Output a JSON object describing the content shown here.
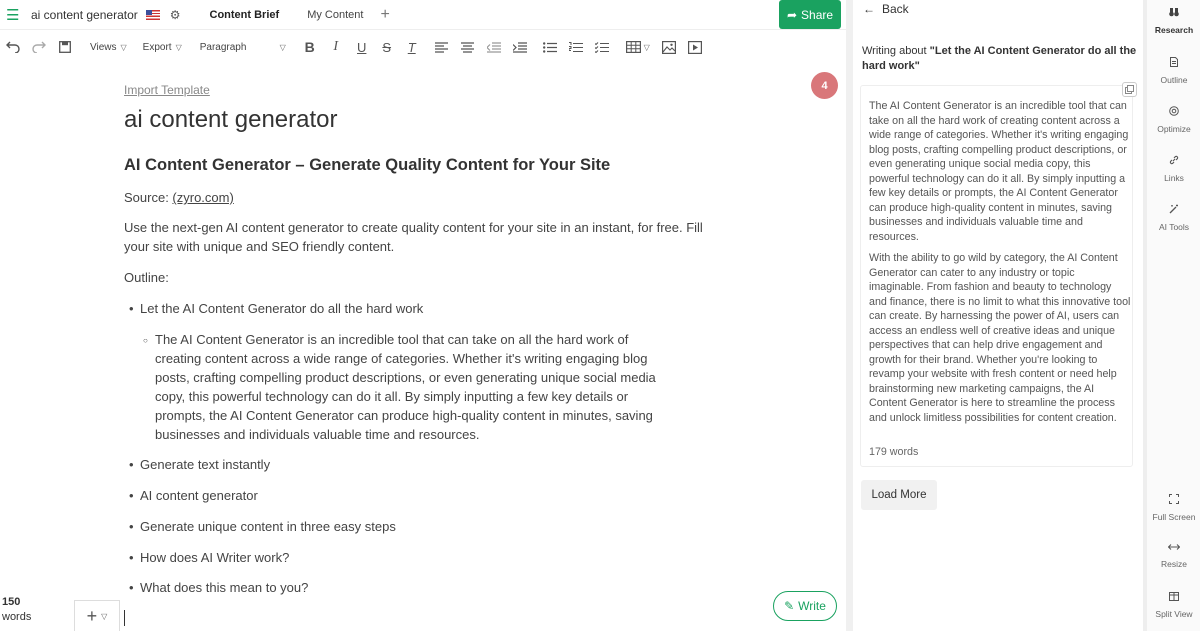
{
  "topbar": {
    "doc_title": "ai content generator",
    "tabs": [
      "Content Brief",
      "My Content"
    ],
    "add_tab": "+",
    "share_label": "Share"
  },
  "toolbar": {
    "views_label": "Views",
    "export_label": "Export",
    "paragraph_label": "Paragraph"
  },
  "editor": {
    "import_template": "Import Template",
    "badge_count": "4",
    "title": "ai content generator",
    "heading": "AI Content Generator – Generate Quality Content for Your Site",
    "source_prefix": "Source: ",
    "source_link": "(zyro.com)",
    "intro": "Use the next-gen AI content generator to create quality content for your site in an instant, for free. Fill your site with unique and SEO friendly content.",
    "outline_label": "Outline:",
    "outline": [
      "Let the AI Content Generator do all the hard work",
      "Generate text instantly",
      "AI content generator",
      "Generate unique content in three easy steps",
      "How does AI Writer work?",
      "What does this mean to you?"
    ],
    "sub_item": "The AI Content Generator is an incredible tool that can take on all the hard work of creating content across a wide range of categories. Whether it's writing engaging blog posts, crafting compelling product descriptions, or even generating unique social media copy, this powerful technology can do it all. By simply inputting a few key details or prompts, the AI Content Generator can produce high-quality content in minutes, saving businesses and individuals valuable time and resources.",
    "word_count": "150",
    "word_label": "words",
    "write_label": "Write"
  },
  "panel": {
    "back_label": "Back",
    "writing_prefix": "Writing about ",
    "writing_topic": "\"Let the AI Content Generator do all the hard work\"",
    "paragraph_1": "The AI Content Generator is an incredible tool that can take on all the hard work of creating content across a wide range of categories. Whether it's writing engaging blog posts, crafting compelling product descriptions, or even generating unique social media copy, this powerful technology can do it all. By simply inputting a few key details or prompts, the AI Content Generator can produce high-quality content in minutes, saving businesses and individuals valuable time and resources.",
    "paragraph_2": "With the ability to go wild by category, the AI Content Generator can cater to any industry or topic imaginable. From fashion and beauty to technology and finance, there is no limit to what this innovative tool can create. By harnessing the power of AI, users can access an endless well of creative ideas and unique perspectives that can help drive engagement and growth for their brand. Whether you're looking to revamp your website with fresh content or need help brainstorming new marketing campaigns, the AI Content Generator is here to streamline the process and unlock limitless possibilities for content creation.",
    "words": "179 words",
    "load_more": "Load More"
  },
  "rail": {
    "items": [
      "Research",
      "Outline",
      "Optimize",
      "Links",
      "AI Tools",
      "Full Screen",
      "Resize",
      "Split View"
    ]
  },
  "colors": {
    "accent": "#1aa260",
    "badge": "#d9777a"
  }
}
